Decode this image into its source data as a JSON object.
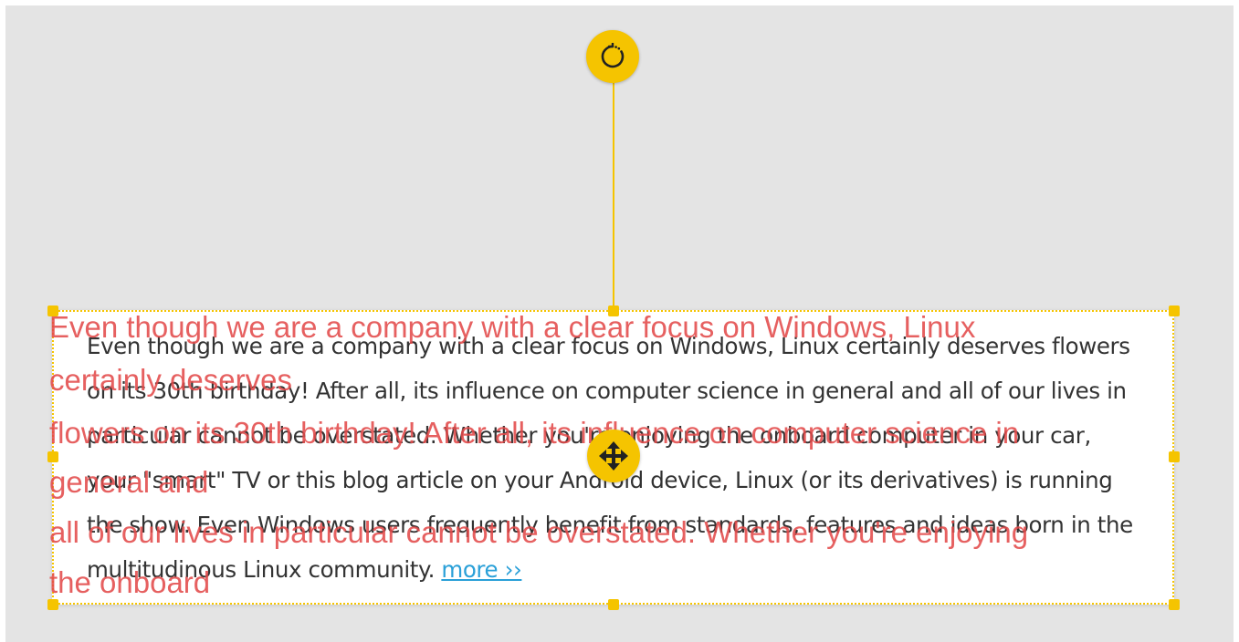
{
  "editor": {
    "body_text": "Even though we are a company with a clear focus on Windows, Linux certainly deserves flowers on its 30th birthday! After all, its influence on computer science in general and all of our lives in particular cannot be overstated. Whether you're enjoying the onboard computer in your car, your \"smart\" TV or this blog article on your Android device, Linux (or its derivatives) is running the show. Even Windows users frequently benefit from standards, features and ideas born in the multitudinous Linux community.",
    "more_link": "more ››",
    "overlay_lines": [
      "Even though we are a company with a clear focus on Windows, Linux",
      "certainly deserves",
      "flowers on its 30th birthday! After all, its influence on computer science in",
      "general and",
      "all of our lives in particular cannot be overstated. Whether you're enjoying",
      "the onboard"
    ]
  },
  "icons": {
    "rotate": "rotate-icon",
    "move": "move-icon"
  },
  "colors": {
    "accent": "#f5c400",
    "canvas_bg": "#e4e4e4",
    "overlay_text": "#e24a4a",
    "link": "#2aa0d8",
    "body_text": "#333333"
  }
}
